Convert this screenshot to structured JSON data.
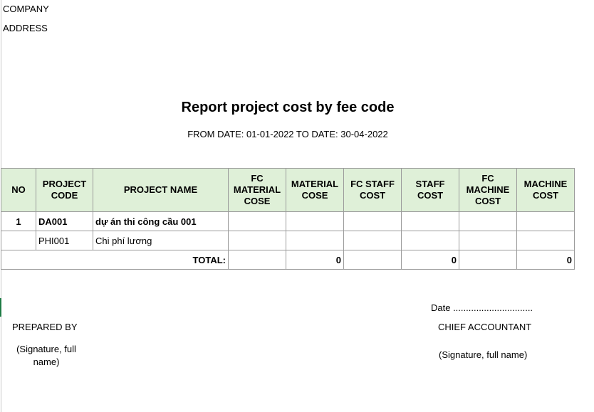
{
  "header": {
    "company": "COMPANY",
    "address": "ADDRESS",
    "title": "Report project cost by fee code",
    "date_range": "FROM DATE: 01-01-2022 TO DATE: 30-04-2022"
  },
  "table": {
    "columns": [
      "NO",
      "PROJECT CODE",
      "PROJECT NAME",
      "FC MATERIAL COSE",
      "MATERIAL COSE",
      "FC STAFF COST",
      "STAFF COST",
      "FC MACHINE COST",
      "MACHINE COST"
    ],
    "rows": [
      [
        "1",
        "DA001",
        "dự án thi công cầu 001",
        "",
        "",
        "",
        "",
        "",
        ""
      ],
      [
        "",
        "PHI001",
        "Chi phí lương",
        "",
        "",
        "",
        "",
        "",
        ""
      ]
    ],
    "total": {
      "label": "TOTAL:",
      "values": [
        "",
        "0",
        "",
        "0",
        "",
        "0"
      ]
    }
  },
  "footer": {
    "date_line": "Date ...............................",
    "prepared_by": "PREPARED BY",
    "chief_accountant": "CHIEF ACCOUNTANT",
    "signature_left": "(Signature, full name)",
    "signature_right": "(Signature, full name)"
  }
}
